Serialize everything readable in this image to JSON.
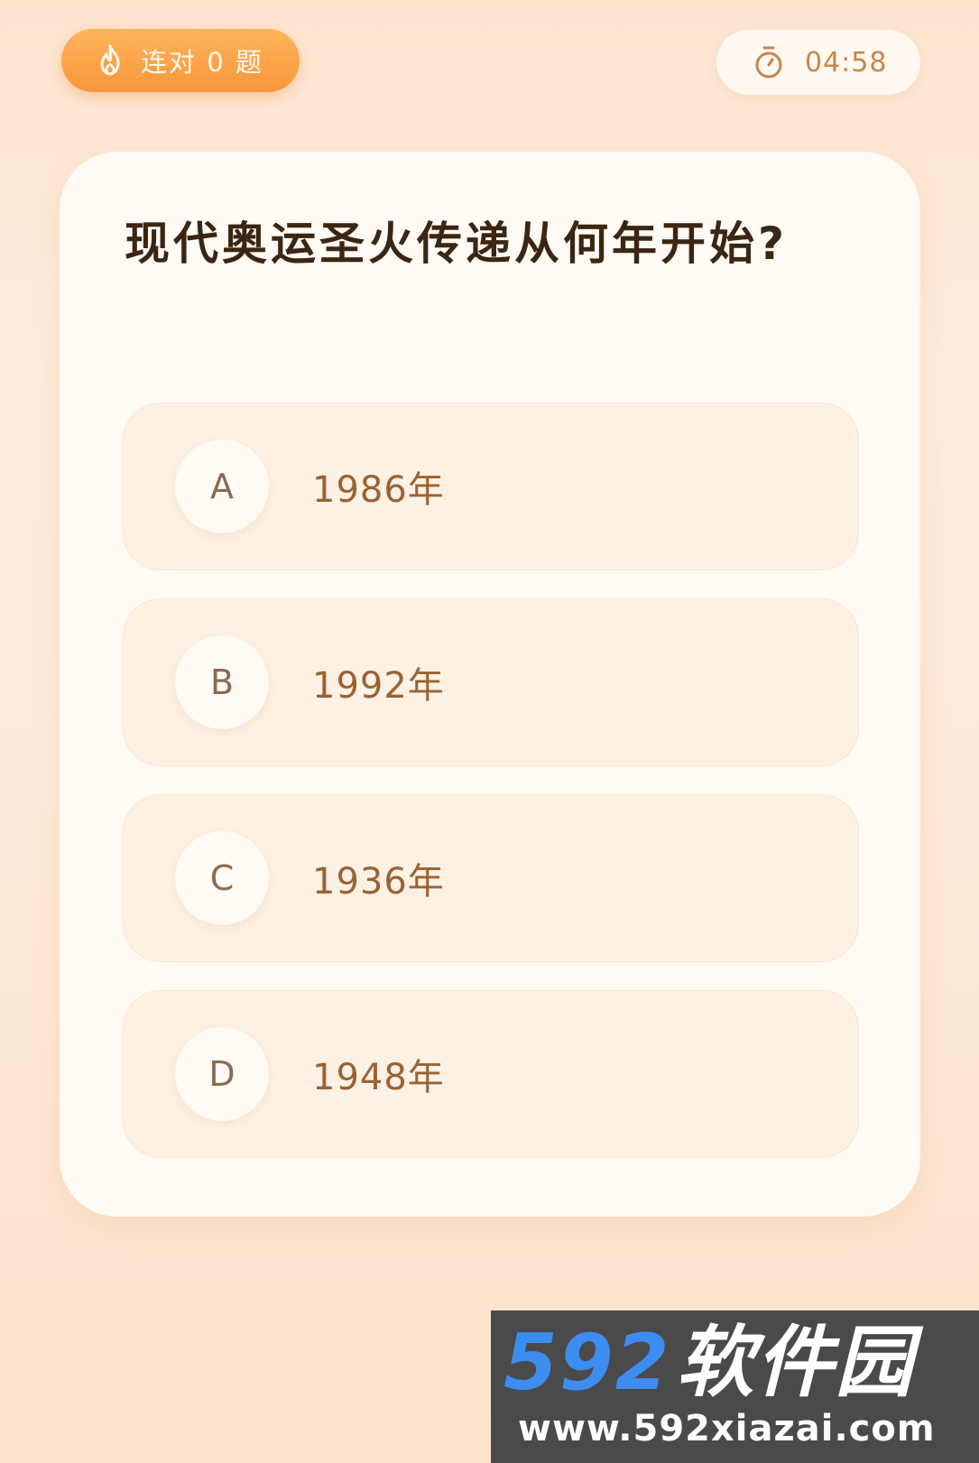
{
  "streak": {
    "icon": "flame-icon",
    "label": "连对 0 题"
  },
  "timer": {
    "icon": "stopwatch-icon",
    "time": "04:58"
  },
  "question": {
    "text": "现代奥运圣火传递从何年开始?"
  },
  "options": [
    {
      "letter": "A",
      "text": "1986年"
    },
    {
      "letter": "B",
      "text": "1992年"
    },
    {
      "letter": "C",
      "text": "1936年"
    },
    {
      "letter": "D",
      "text": "1948年"
    }
  ],
  "watermark": {
    "number": "592",
    "name": "软件园",
    "url": "www.592xiazai.com"
  },
  "colors": {
    "accent_orange": "#f7963c",
    "timer_text": "#c8854a",
    "option_text": "#9a6233",
    "watermark_blue": "#3d8cf0"
  }
}
